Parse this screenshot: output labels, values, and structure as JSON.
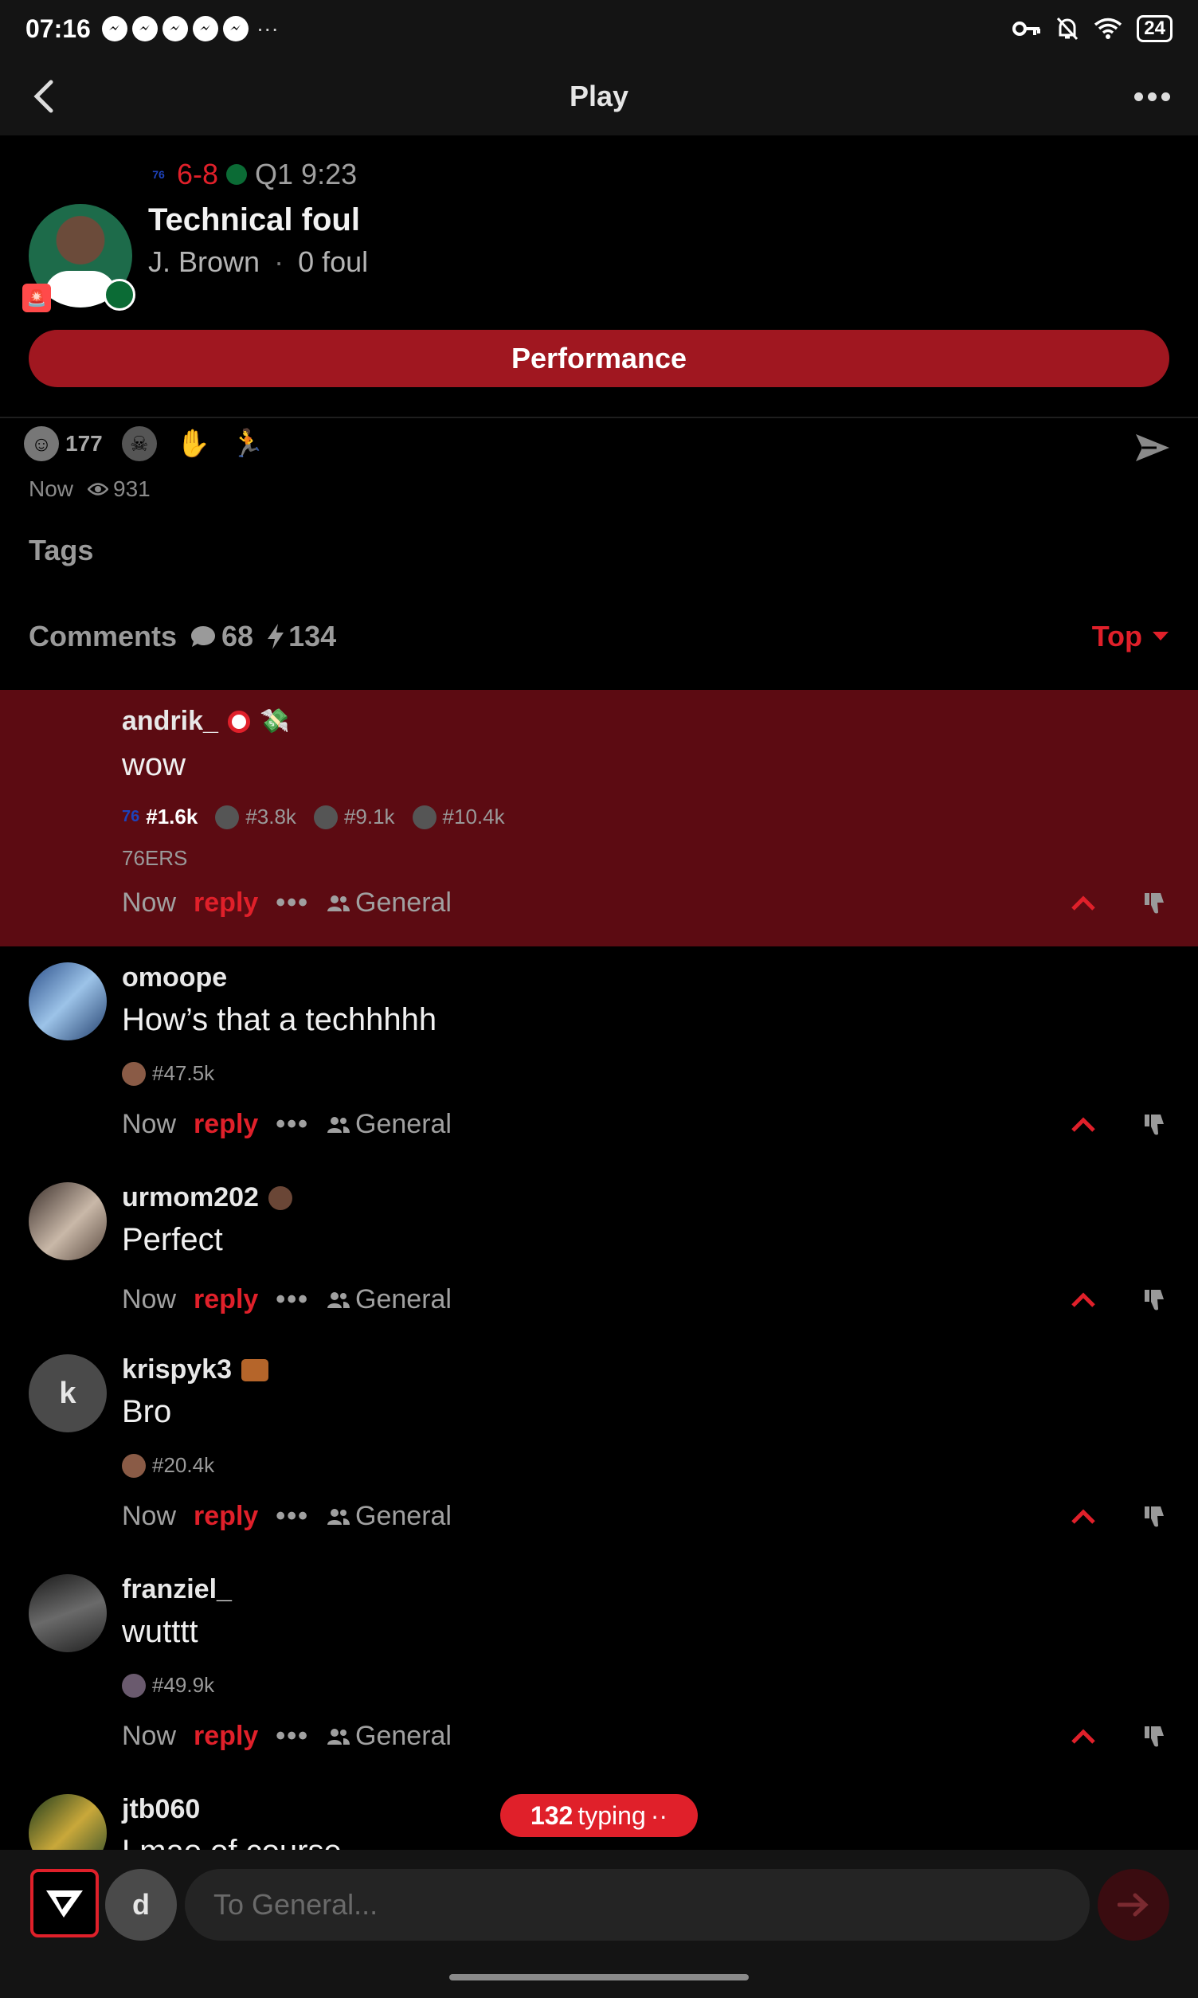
{
  "status_bar": {
    "time": "07:16",
    "more": "···",
    "battery": "24"
  },
  "nav": {
    "title": "Play"
  },
  "play": {
    "score": "6-8",
    "period_clock": "Q1 9:23",
    "title": "Technical foul",
    "player": "J. Brown",
    "separator": "·",
    "foul_count": "0 foul",
    "performance_label": "Performance"
  },
  "reactions": {
    "count": "177"
  },
  "meta": {
    "time": "Now",
    "views": "931"
  },
  "tags_label": "Tags",
  "comments_header": {
    "label": "Comments",
    "comment_count": "68",
    "bolt_count": "134",
    "sort": "Top"
  },
  "comments": [
    {
      "user": "andrik_",
      "text": "wow",
      "ranks": [
        "#1.6k",
        "#3.8k",
        "#9.1k",
        "#10.4k"
      ],
      "team": "76ERS",
      "time": "Now",
      "reply": "reply",
      "more": "•••",
      "channel": "General"
    },
    {
      "user": "omoope",
      "text": "How’s that a techhhhh",
      "ranks": [
        "#47.5k"
      ],
      "time": "Now",
      "reply": "reply",
      "more": "•••",
      "channel": "General"
    },
    {
      "user": "urmom202",
      "text": "Perfect",
      "time": "Now",
      "reply": "reply",
      "more": "•••",
      "channel": "General"
    },
    {
      "user": "krispyk3",
      "avatar_letter": "k",
      "text": "Bro",
      "ranks": [
        "#20.4k"
      ],
      "time": "Now",
      "reply": "reply",
      "more": "•••",
      "channel": "General"
    },
    {
      "user": "franziel_",
      "text": "wutttt",
      "ranks": [
        "#49.9k"
      ],
      "time": "Now",
      "reply": "reply",
      "more": "•••",
      "channel": "General"
    },
    {
      "user": "jtb060",
      "text": "Lmao of course"
    }
  ],
  "typing": {
    "count": "132",
    "label": "typing",
    "dots": "··"
  },
  "compose": {
    "avatar_letter": "d",
    "placeholder": "To General..."
  },
  "colors": {
    "accent": "#e0202a",
    "highlight_bg": "#5c0b12",
    "button_bg": "#a01720",
    "background": "#000000"
  }
}
